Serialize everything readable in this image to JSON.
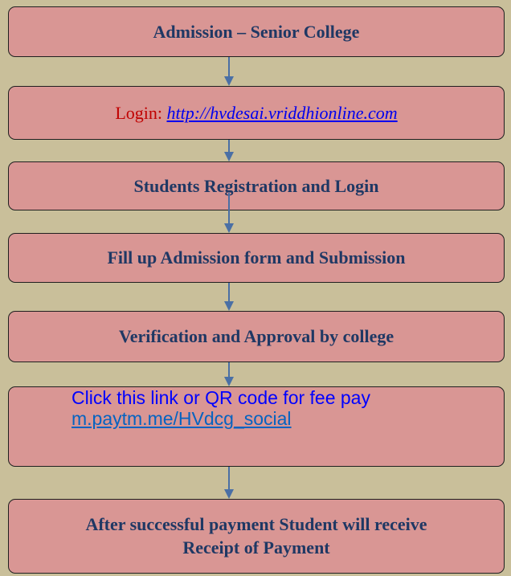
{
  "steps": {
    "admission": "Admission – Senior College",
    "login_prefix": "Login: ",
    "login_url": "http://hvdesai.vriddhionline.com",
    "registration": "Students Registration and Login",
    "fill_form": "Fill up Admission form and Submission",
    "verification": "Verification and Approval by college",
    "payment_text": "Click this link or QR code for fee pay",
    "payment_link": "m.paytm.me/HVdcg_social",
    "final_line1": "After successful payment Student will receive",
    "final_line2": "Receipt of Payment"
  },
  "colors": {
    "background": "#c9bf9a",
    "box_fill": "#d99694",
    "text": "#1f3864",
    "arrow": "#4a6fa5",
    "login_label": "#c00000",
    "link": "#0000ee"
  }
}
